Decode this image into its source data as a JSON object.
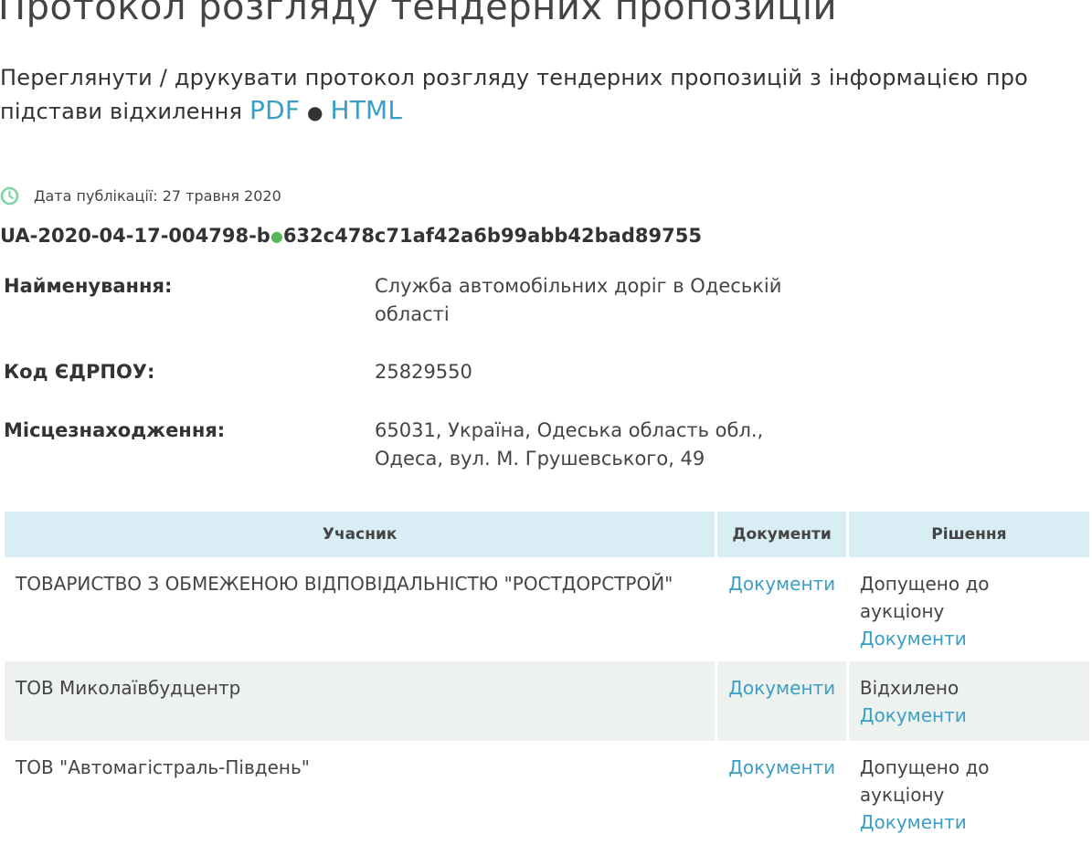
{
  "page": {
    "title": "Протокол розгляду тендерних пропозицій",
    "subtitle_text": "Переглянути / друкувати протокол розгляду тендерних пропозицій з інформацією про підстави відхилення",
    "pdf_link": "PDF",
    "separator": "●",
    "html_link": "HTML"
  },
  "publication": {
    "icon": "clock-icon",
    "label": "Дата публікації: 27 травня 2020"
  },
  "tender": {
    "id_prefix": "UA-2020-04-17-004798-b",
    "dot": "●",
    "id_suffix": "632c478c71af42a6b99abb42bad89755"
  },
  "info": {
    "name_label": "Найменування:",
    "name_value": "Служба автомобільних доріг в Одеській області",
    "code_label": "Код ЄДРПОУ:",
    "code_value": "25829550",
    "location_label": "Місцезнаходження:",
    "location_value": "65031, Україна, Одеська область обл., Одеса, вул. М. Грушевського, 49"
  },
  "table": {
    "headers": [
      "Учасник",
      "Документи",
      "Рішення"
    ],
    "rows": [
      {
        "participant": "ТОВАРИСТВО З ОБМЕЖЕНОЮ ВІДПОВІДАЛЬНІСТЮ \"РОСТДОРСТРОЙ\"",
        "documents": "Документи",
        "decision": "Допущено до аукціону",
        "decision_docs": "Документи"
      },
      {
        "participant": "ТОВ Миколаївбудцентр",
        "documents": "Документи",
        "decision": "Відхилено",
        "decision_docs": "Документи"
      },
      {
        "participant": "ТОВ \"Автомагістраль-Південь\"",
        "documents": "Документи",
        "decision": "Допущено до аукціону",
        "decision_docs": "Документи"
      }
    ]
  },
  "colors": {
    "link": "#3a9fc6",
    "header_bg": "#d8edf4",
    "stripe_bg": "#eef2ef",
    "clock_green": "#7fd4a3",
    "dot_green": "#5bb55a"
  }
}
